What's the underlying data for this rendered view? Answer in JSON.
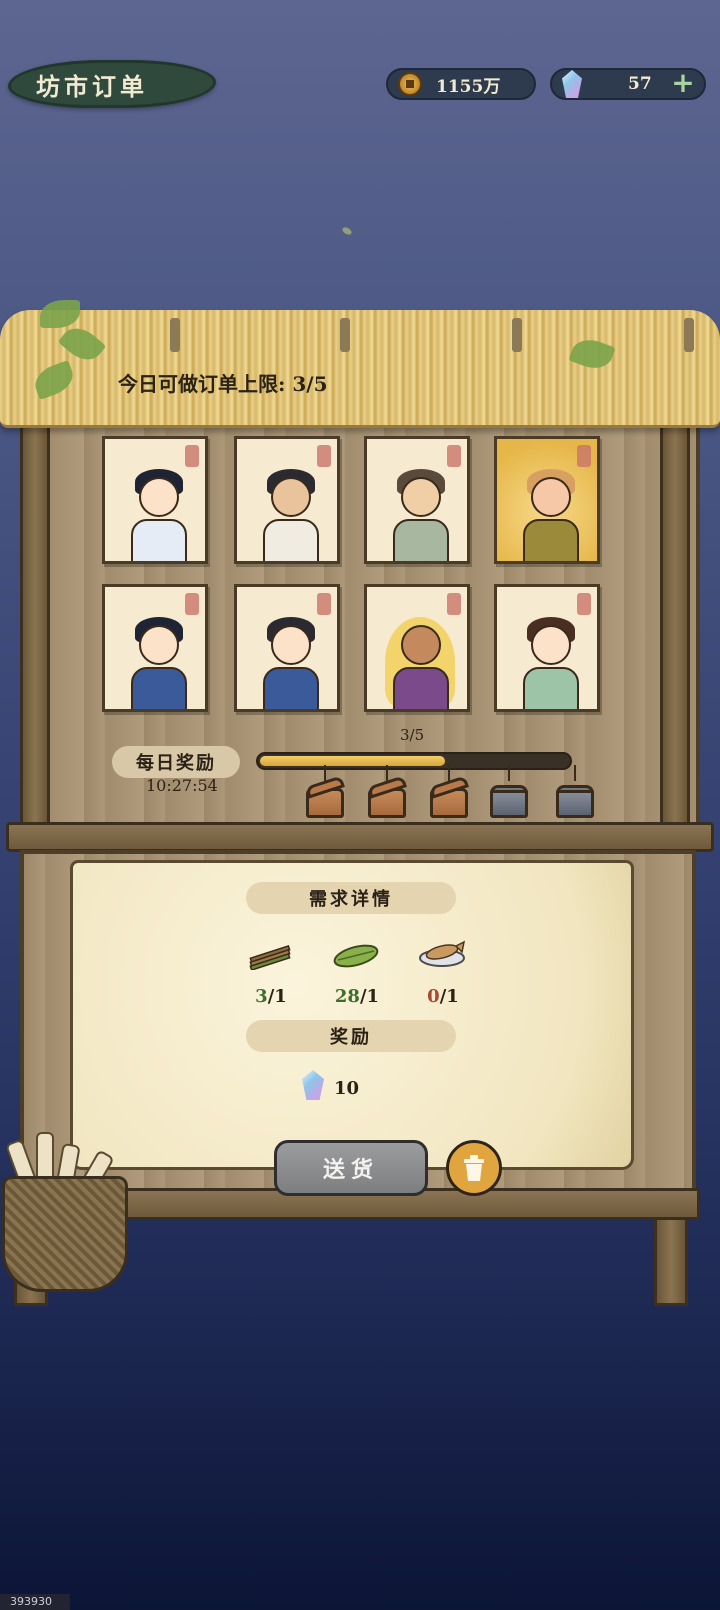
{
  "header": {
    "title": "坊市订单",
    "coins": "1155万",
    "gems": "57",
    "coin_icon": "coin-icon",
    "gem_icon": "gem-icon",
    "add_icon": "plus-icon"
  },
  "shop": {
    "order_limit_label": "今日可做订单上限: 3/5",
    "customers": [
      {
        "name": "customer-1",
        "style": "normal"
      },
      {
        "name": "customer-2",
        "style": "normal"
      },
      {
        "name": "customer-3",
        "style": "normal"
      },
      {
        "name": "customer-4",
        "style": "gold"
      },
      {
        "name": "customer-5",
        "style": "normal"
      },
      {
        "name": "customer-6",
        "style": "normal"
      },
      {
        "name": "customer-7",
        "style": "normal"
      },
      {
        "name": "customer-8",
        "style": "normal"
      }
    ],
    "daily_reward_label": "每日奖励",
    "daily_reward_timer": "10:27:54",
    "progress_text": "3/5",
    "progress_value": 3,
    "progress_max": 5,
    "chests": [
      "open",
      "open",
      "open",
      "locked",
      "locked"
    ]
  },
  "order_detail": {
    "demand_header": "需求详情",
    "items": [
      {
        "icon": "bamboo-sticks-icon",
        "have": "3",
        "need": "/1",
        "status": "green"
      },
      {
        "icon": "leaf-wrap-icon",
        "have": "28",
        "need": "/1",
        "status": "green"
      },
      {
        "icon": "fish-dish-icon",
        "have": "0",
        "need": "/1",
        "status": "red"
      }
    ],
    "reward_header": "奖励",
    "reward_icon": "gem-icon",
    "reward_amount": "10",
    "deliver_label": "送货",
    "trash_icon": "trash-icon"
  },
  "footer": {
    "build_id": "393930"
  },
  "colors": {
    "bg_top": "#5d6690",
    "bg_bottom": "#0c1536",
    "wood": "#9c8868",
    "paper": "#fbf4dc",
    "have_ok": "#3e6e2c",
    "have_missing": "#a84a32",
    "trash_button": "#e1a540"
  }
}
